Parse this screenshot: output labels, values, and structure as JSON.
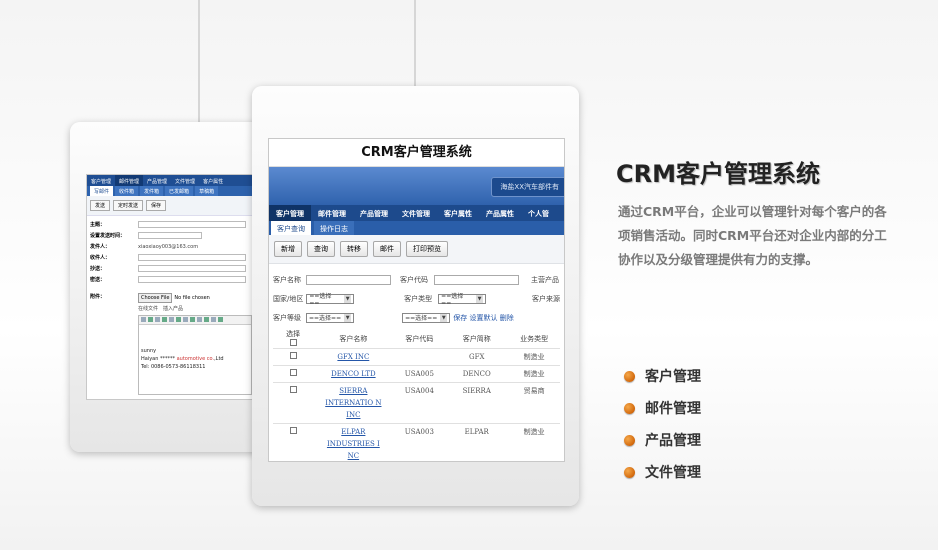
{
  "heading": "CRM客户管理系统",
  "description": "通过CRM平台，企业可以管理针对每个客户的各项销售活动。同时CRM平台还对企业内部的分工协作以及分级管理提供有力的支撑。",
  "features": [
    "客户管理",
    "邮件管理",
    "产品管理",
    "文件管理"
  ],
  "colors": {
    "nav_blue": "#1d4a8c",
    "accent_orange": "#e07a14"
  },
  "back_screen": {
    "nav": [
      "客户管理",
      "邮件管理",
      "产品管理",
      "文件管理",
      "客户属性"
    ],
    "sub_tabs": [
      "写邮件",
      "收件箱",
      "发件箱",
      "已发邮箱",
      "草稿箱"
    ],
    "tools": [
      "发送",
      "定时发送",
      "保存"
    ],
    "fields": {
      "subject": "主题：",
      "schedule": "设置发送时间：",
      "sender": "发件人：",
      "sender_value": "xiaoxiaoy003@163.com",
      "recipient": "收件人：",
      "cc": "抄送：",
      "bcc": "密送："
    },
    "attach_label": "附件：",
    "choose_file": "Choose File",
    "no_file": "No file chosen",
    "attach_links": "在线文件　插入产品",
    "signature": {
      "name": "sunny",
      "line": "Haiyan ******",
      "company": "automotive co.",
      "company_suffix": ",Ltd",
      "tel": "Tel: 0086-0573-86118311"
    }
  },
  "front_screen": {
    "title": "CRM客户管理系统",
    "banner_tag": "海盐XX汽车部件有",
    "nav": [
      "客户管理",
      "邮件管理",
      "产品管理",
      "文件管理",
      "客户属性",
      "产品属性",
      "个人管"
    ],
    "sub_tabs": [
      "客户查询",
      "操作日志"
    ],
    "tools": [
      "新增",
      "查询",
      "转移",
      "邮件",
      "打印预览"
    ],
    "form": {
      "customer_name": "客户名称",
      "customer_code": "客户代码",
      "main_product": "主营产品",
      "region": "国家/地区",
      "customer_type": "客户类型",
      "customer_source": "客户来源",
      "customer_level": "客户等级",
      "select_placeholder": "==选择==",
      "save_defaults": "保存 设置默认 删除"
    },
    "table": {
      "headers": [
        "选择",
        "客户名称",
        "客户代码",
        "客户简称",
        "业务类型"
      ],
      "rows": [
        {
          "name": "GFX INC",
          "code": "",
          "short": "GFX",
          "type": "制造业"
        },
        {
          "name": "DENCO LTD",
          "code": "USA005",
          "short": "DENCO",
          "type": "制造业"
        },
        {
          "name": "SIERRA INTERNATIO N INC",
          "code": "USA004",
          "short": "SIERRA",
          "type": "贸易商"
        },
        {
          "name": "ELPAR INDUSTRIES I NC",
          "code": "USA003",
          "short": "ELPAR",
          "type": "制造业"
        }
      ]
    }
  }
}
